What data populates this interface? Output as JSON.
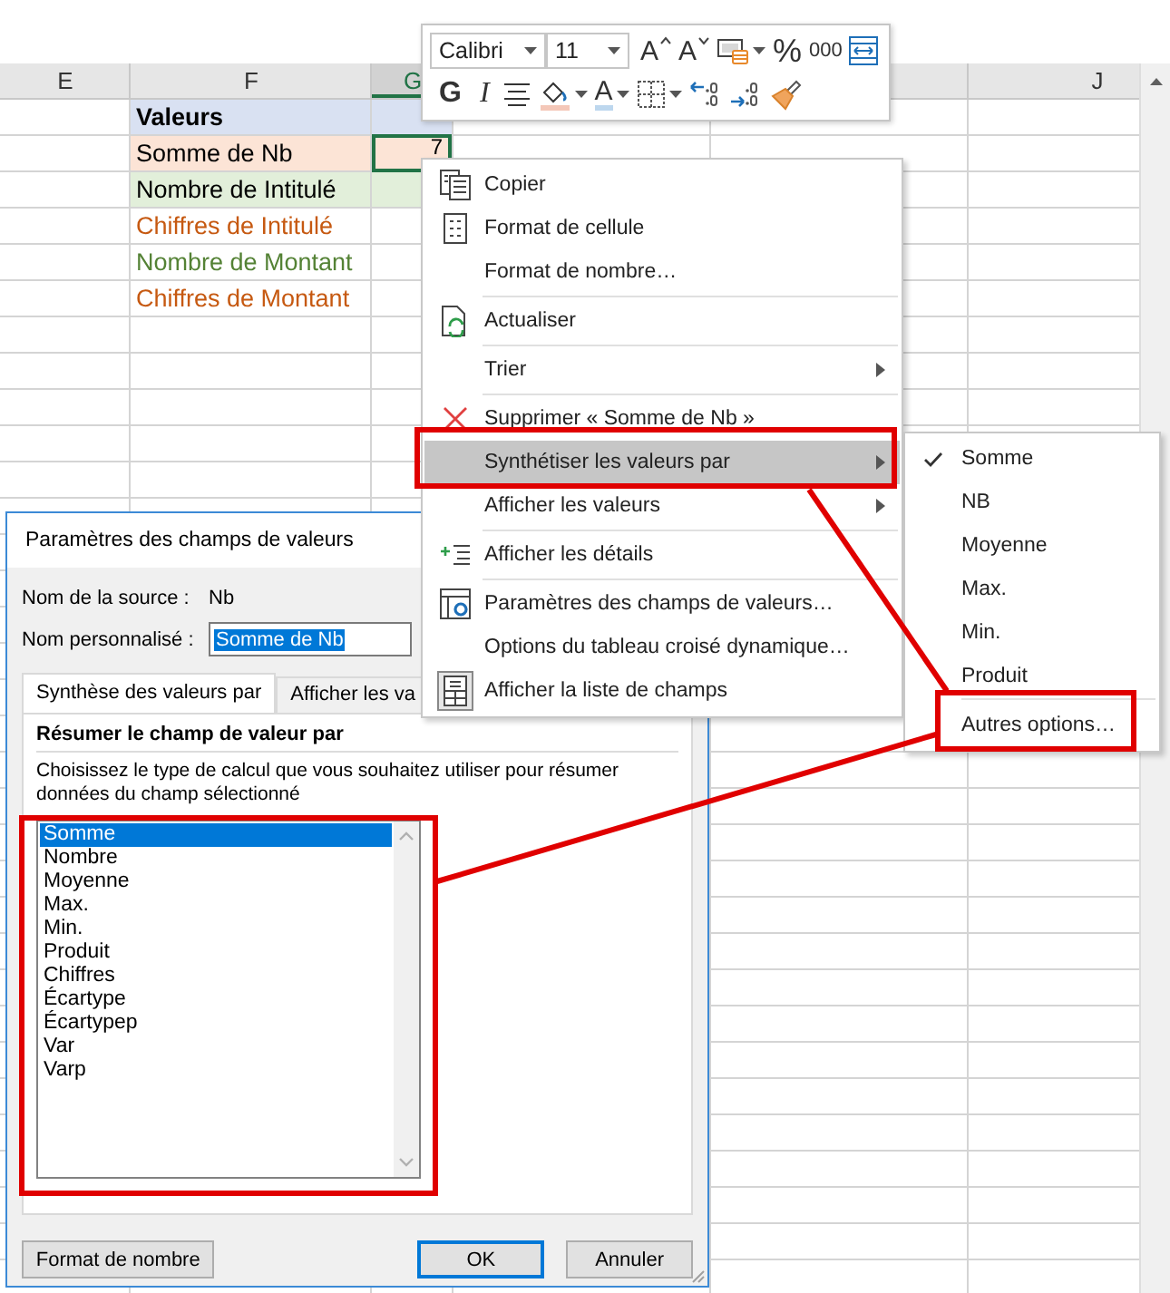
{
  "sheet": {
    "columns": [
      {
        "label": "E",
        "selected": false
      },
      {
        "label": "F",
        "selected": false
      },
      {
        "label": "G",
        "selected": true
      },
      {
        "label": "J",
        "selected": false
      }
    ],
    "rows": [
      {
        "kind": "header",
        "label": "Valeurs",
        "color": "#000000",
        "selected": false
      },
      {
        "kind": "sum",
        "label": "Somme de Nb",
        "value": "7",
        "color": "#000000",
        "selected": true
      },
      {
        "kind": "count",
        "label": "Nombre de Intitulé",
        "color": "#000000",
        "selected": false
      },
      {
        "kind": "plain",
        "label": "Chiffres de Intitulé",
        "color": "#c65911",
        "selected": false
      },
      {
        "kind": "plain",
        "label": "Nombre de Montant",
        "color": "#548235",
        "selected": false
      },
      {
        "kind": "plain",
        "label": "Chiffres de Montant",
        "color": "#c65911",
        "selected": false
      }
    ]
  },
  "mini_toolbar": {
    "font": "Calibri",
    "size": "11",
    "row_1": [
      {
        "kind": "grow-font",
        "label": "A",
        "dropdown": false
      },
      {
        "kind": "shrink-font",
        "label": "A",
        "dropdown": false
      },
      {
        "kind": "cell-style",
        "dropdown": true
      },
      {
        "kind": "text",
        "label": "%",
        "dropdown": false
      },
      {
        "kind": "text",
        "label": "000",
        "dropdown": false
      },
      {
        "kind": "wrap",
        "dropdown": false
      }
    ],
    "row_2": [
      {
        "kind": "bold",
        "label": "G",
        "dropdown": false
      },
      {
        "kind": "italic",
        "label": "I",
        "dropdown": false
      },
      {
        "kind": "align",
        "dropdown": false
      },
      {
        "kind": "fill-color",
        "dropdown": true
      },
      {
        "kind": "font-color",
        "label": "A",
        "dropdown": true
      },
      {
        "kind": "borders",
        "dropdown": true
      },
      {
        "kind": "increase-decimal",
        "dropdown": false
      },
      {
        "kind": "decrease-decimal",
        "dropdown": false
      },
      {
        "kind": "format-painter",
        "dropdown": false
      }
    ]
  },
  "context_menu": {
    "items": [
      {
        "kind": "copy",
        "label": "Copier",
        "submenu": false,
        "highlighted": false
      },
      {
        "kind": "format-cells",
        "label": "Format de cellule",
        "submenu": false,
        "highlighted": false
      },
      {
        "kind": "plain",
        "label": "Format de nombre…",
        "submenu": false,
        "highlighted": false
      },
      {
        "kind": "separator"
      },
      {
        "kind": "refresh",
        "label": "Actualiser",
        "submenu": false,
        "highlighted": false
      },
      {
        "kind": "separator"
      },
      {
        "kind": "plain",
        "label": "Trier",
        "submenu": true,
        "highlighted": false
      },
      {
        "kind": "separator"
      },
      {
        "kind": "delete",
        "label": "Supprimer « Somme de Nb »",
        "submenu": false,
        "highlighted": false
      },
      {
        "kind": "plain",
        "label": "Synthétiser les valeurs par",
        "submenu": true,
        "highlighted": true
      },
      {
        "kind": "plain",
        "label": "Afficher les valeurs",
        "submenu": true,
        "highlighted": false
      },
      {
        "kind": "separator"
      },
      {
        "kind": "details",
        "label": "Afficher les détails",
        "submenu": false,
        "highlighted": false
      },
      {
        "kind": "separator"
      },
      {
        "kind": "field-settings",
        "label": "Paramètres des champs de valeurs…",
        "submenu": false,
        "highlighted": false
      },
      {
        "kind": "plain",
        "label": "Options du tableau croisé dynamique…",
        "submenu": false,
        "highlighted": false
      },
      {
        "kind": "field-list",
        "label": "Afficher la liste de champs",
        "submenu": false,
        "highlighted": false
      }
    ]
  },
  "submenu": {
    "items": [
      {
        "kind": "item",
        "label": "Somme",
        "checked": true
      },
      {
        "kind": "item",
        "label": "NB",
        "checked": false
      },
      {
        "kind": "item",
        "label": "Moyenne",
        "checked": false
      },
      {
        "kind": "item",
        "label": "Max.",
        "checked": false
      },
      {
        "kind": "item",
        "label": "Min.",
        "checked": false
      },
      {
        "kind": "item",
        "label": "Produit",
        "checked": false
      },
      {
        "kind": "separator"
      },
      {
        "kind": "item",
        "label": "Autres options…",
        "checked": false
      }
    ]
  },
  "dialog": {
    "title": "Paramètres des champs de valeurs",
    "source_label": "Nom de la source :",
    "source_value": "Nb",
    "custom_label": "Nom personnalisé :",
    "custom_value": "Somme de Nb",
    "tabs": [
      {
        "label": "Synthèse des valeurs par",
        "selected": true
      },
      {
        "label": "Afficher les va",
        "selected": false
      }
    ],
    "section_title": "Résumer le champ de valeur par",
    "description": "Choisissez le type de calcul que vous souhaitez utiliser pour résumer données du champ sélectionné",
    "list": [
      {
        "label": "Somme",
        "selected": true
      },
      {
        "label": "Nombre",
        "selected": false
      },
      {
        "label": "Moyenne",
        "selected": false
      },
      {
        "label": "Max.",
        "selected": false
      },
      {
        "label": "Min.",
        "selected": false
      },
      {
        "label": "Produit",
        "selected": false
      },
      {
        "label": "Chiffres",
        "selected": false
      },
      {
        "label": "Écartype",
        "selected": false
      },
      {
        "label": "Écartypep",
        "selected": false
      },
      {
        "label": "Var",
        "selected": false
      },
      {
        "label": "Varp",
        "selected": false
      }
    ],
    "buttons": [
      {
        "label": "Format de nombre",
        "kind": "left",
        "default": false
      },
      {
        "label": "OK",
        "kind": "right",
        "default": true
      },
      {
        "label": "Annuler",
        "kind": "right",
        "default": false
      }
    ]
  }
}
